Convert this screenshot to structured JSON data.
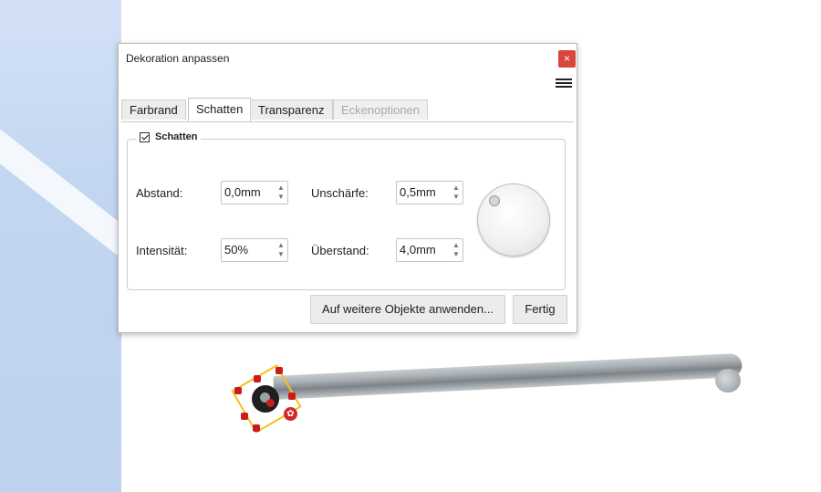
{
  "dialog": {
    "title": "Dekoration anpassen",
    "close_symbol": "×",
    "menu_icon": "hamburger-icon"
  },
  "tabs": [
    {
      "label": "Farbrand",
      "state": "normal"
    },
    {
      "label": "Schatten",
      "state": "active"
    },
    {
      "label": "Transparenz",
      "state": "normal"
    },
    {
      "label": "Eckenoptionen",
      "state": "disabled"
    }
  ],
  "shadow": {
    "checkbox_checked": true,
    "legend": "Schatten",
    "abstand_label": "Abstand:",
    "abstand_value": "0,0mm",
    "unschaerfe_label": "Unschärfe:",
    "unschaerfe_value": "0,5mm",
    "intensitaet_label": "Intensität:",
    "intensitaet_value": "50%",
    "ueberstand_label": "Überstand:",
    "ueberstand_value": "4,0mm",
    "direction_dial_icon": "direction-dial"
  },
  "buttons": {
    "apply_label": "Auf weitere Objekte anwenden...",
    "done_label": "Fertig"
  },
  "colors": {
    "close_button": "#d9453c",
    "selection_border": "#f3c21b",
    "handle": "#cc1b1b"
  }
}
